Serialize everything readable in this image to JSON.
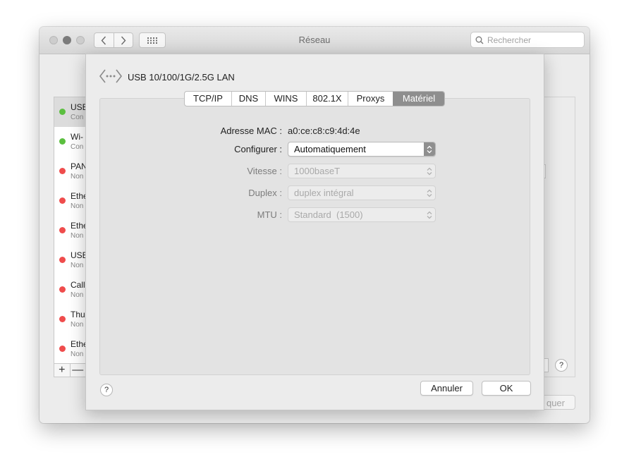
{
  "window": {
    "title": "Réseau",
    "search_placeholder": "Rechercher"
  },
  "network_list": {
    "items": [
      {
        "name": "USB",
        "status": "Con",
        "color": "#5bbf3f",
        "selected": true
      },
      {
        "name": "Wi-",
        "status": "Con",
        "color": "#5bbf3f",
        "selected": false
      },
      {
        "name": "PAN",
        "status": "Non",
        "color": "#ef4c4c",
        "selected": false
      },
      {
        "name": "Ethe",
        "status": "Non",
        "color": "#ef4c4c",
        "selected": false
      },
      {
        "name": "Ethe",
        "status": "Non",
        "color": "#ef4c4c",
        "selected": false
      },
      {
        "name": "USB",
        "status": "Non",
        "color": "#ef4c4c",
        "selected": false
      },
      {
        "name": "Call",
        "status": "Non",
        "color": "#ef4c4c",
        "selected": false
      },
      {
        "name": "Thu",
        "status": "Non",
        "color": "#ef4c4c",
        "selected": false
      },
      {
        "name": "Ethe",
        "status": "Non",
        "color": "#ef4c4c",
        "selected": false
      }
    ],
    "add_label": "+",
    "remove_label": "—"
  },
  "background": {
    "apply_label": "quer",
    "help_label": "?"
  },
  "sheet": {
    "interface_name": "USB 10/100/1G/2.5G LAN",
    "tabs": [
      "TCP/IP",
      "DNS",
      "WINS",
      "802.1X",
      "Proxys",
      "Matériel"
    ],
    "active_tab": "Matériel",
    "mac_label": "Adresse MAC :",
    "mac_value": "a0:ce:c8:c9:4d:4e",
    "configure_label": "Configurer :",
    "configure_value": "Automatiquement",
    "speed_label": "Vitesse :",
    "speed_value": "1000baseT",
    "duplex_label": "Duplex :",
    "duplex_value": "duplex intégral",
    "mtu_label": "MTU :",
    "mtu_value": "Standard  (1500)",
    "help_label": "?",
    "cancel_label": "Annuler",
    "ok_label": "OK"
  }
}
